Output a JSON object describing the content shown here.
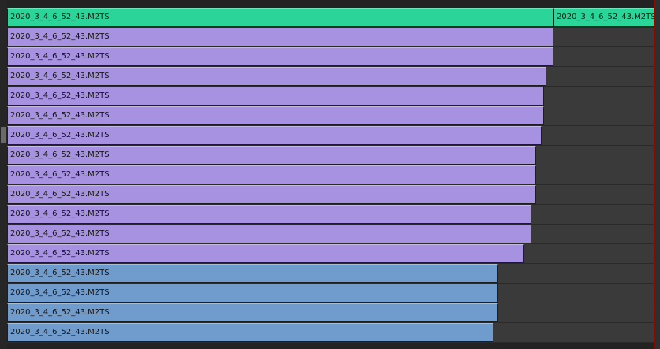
{
  "video_track": {
    "clips": [
      {
        "label": "2020_3_4_6_52_43.M2TS"
      },
      {
        "label": "2020_3_4_6_52_43.M2TS"
      }
    ]
  },
  "audio_tracks": [
    {
      "label": "2020_3_4_6_52_43.M2TS",
      "color": "#a692e1"
    },
    {
      "label": "2020_3_4_6_52_43.M2TS",
      "color": "#a692e1"
    },
    {
      "label": "2020_3_4_6_52_43.M2TS",
      "color": "#a692e1"
    },
    {
      "label": "2020_3_4_6_52_43.M2TS",
      "color": "#a692e1"
    },
    {
      "label": "2020_3_4_6_52_43.M2TS",
      "color": "#a692e1"
    },
    {
      "label": "2020_3_4_6_52_43.M2TS",
      "color": "#a692e1"
    },
    {
      "label": "2020_3_4_6_52_43.M2TS",
      "color": "#a692e1"
    },
    {
      "label": "2020_3_4_6_52_43.M2TS",
      "color": "#a692e1"
    },
    {
      "label": "2020_3_4_6_52_43.M2TS",
      "color": "#a692e1"
    },
    {
      "label": "2020_3_4_6_52_43.M2TS",
      "color": "#a692e1"
    },
    {
      "label": "2020_3_4_6_52_43.M2TS",
      "color": "#a692e1"
    },
    {
      "label": "2020_3_4_6_52_43.M2TS",
      "color": "#a692e1"
    },
    {
      "label": "2020_3_4_6_52_43.M2TS",
      "color": "#6f9bcd"
    },
    {
      "label": "2020_3_4_6_52_43.M2TS",
      "color": "#6f9bcd"
    },
    {
      "label": "2020_3_4_6_52_43.M2TS",
      "color": "#6f9bcd"
    },
    {
      "label": "2020_3_4_6_52_43.M2TS",
      "color": "#6f9bcd"
    }
  ],
  "colors": {
    "video_clip": "#2bd59a",
    "audio_clip_purple": "#a692e1",
    "audio_clip_blue": "#6f9bcd",
    "playhead": "#c0392b"
  }
}
